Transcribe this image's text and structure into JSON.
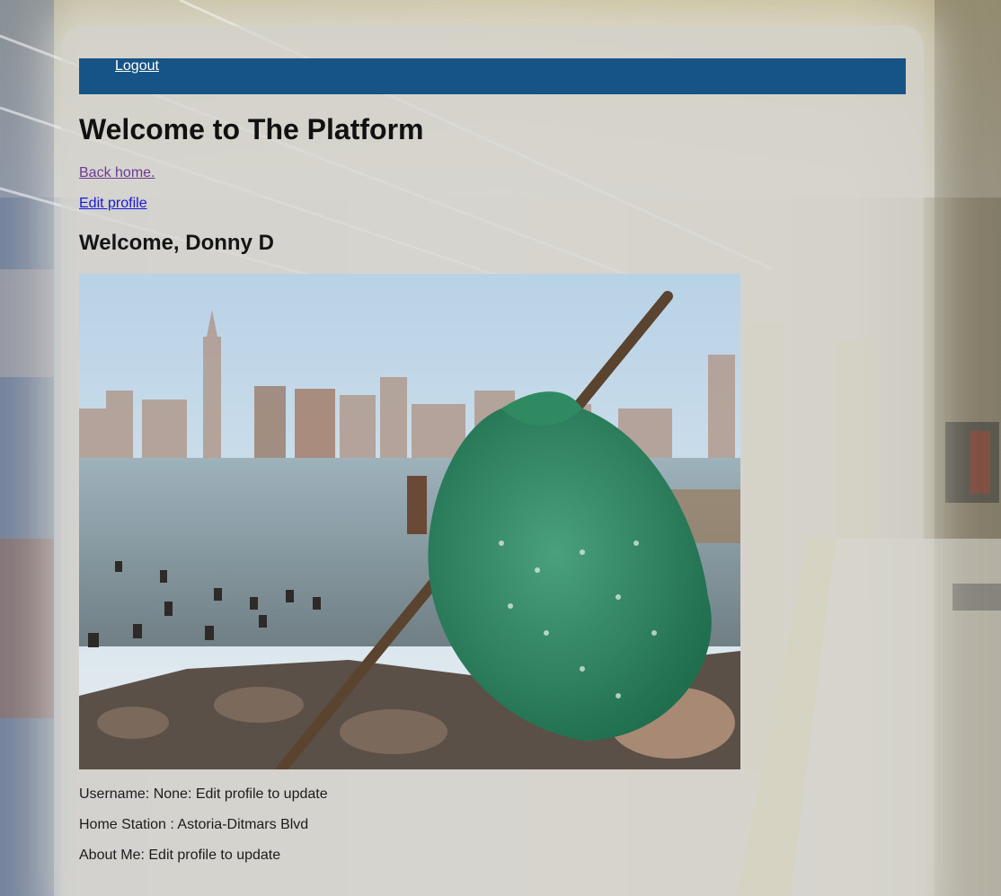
{
  "nav": {
    "logout_label": "Logout"
  },
  "page": {
    "title": "Welcome to The Platform",
    "back_home_label": "Back home.",
    "edit_profile_label": "Edit profile",
    "welcome_text": "Welcome, Donny D"
  },
  "profile": {
    "username_line": "Username: None: Edit profile to update",
    "home_station_line": "Home Station : Astoria-Ditmars Blvd",
    "about_line": "About Me: Edit profile to update"
  },
  "colors": {
    "navbar": "#165488",
    "visited_link": "#6a3a96",
    "link": "#1a1ad6"
  }
}
